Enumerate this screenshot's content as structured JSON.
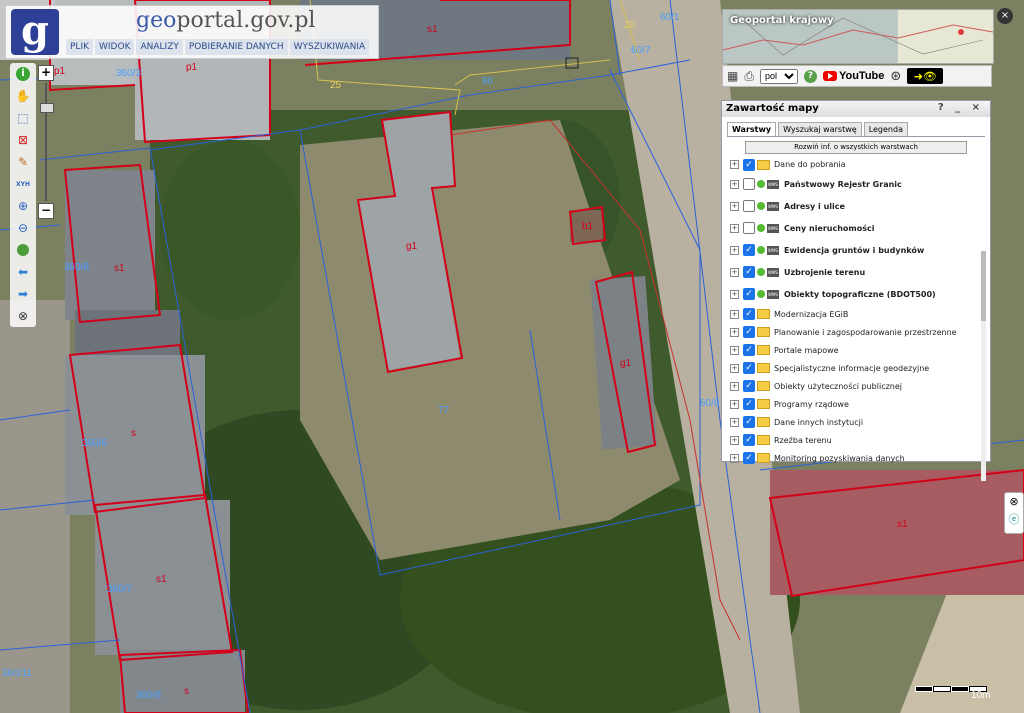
{
  "header": {
    "logo_letter": "g",
    "site_prefix": "geo",
    "site_suffix": "portal.gov.pl",
    "menu": [
      "PLIK",
      "WIDOK",
      "ANALIZY",
      "POBIERANIE DANYCH",
      "WYSZUKIWANIA"
    ]
  },
  "left_tools": {
    "xyh_label": "XYH"
  },
  "zoom": {
    "plus": "+",
    "minus": "−"
  },
  "overview": {
    "title": "Geoportal krajowy"
  },
  "toolbar": {
    "language": "pol",
    "youtube_label": "YouTube",
    "help_symbol": "?"
  },
  "panel": {
    "title": "Zawartość mapy",
    "controls": "? _ ×",
    "tabs": [
      "Warstwy",
      "Wyszukaj warstwę",
      "Legenda"
    ],
    "expand_all": "Rozwiń inf. o wszystkich warstwach",
    "layers": [
      {
        "label": "Dane do pobrania",
        "checked": true,
        "kind": "folder",
        "bold": false
      },
      {
        "label": "Państwowy Rejestr Granic",
        "checked": false,
        "kind": "wms",
        "bold": true
      },
      {
        "label": "Adresy i ulice",
        "checked": false,
        "kind": "wms",
        "bold": true
      },
      {
        "label": "Ceny nieruchomości",
        "checked": false,
        "kind": "wms",
        "bold": true
      },
      {
        "label": "Ewidencja gruntów i budynków",
        "checked": true,
        "kind": "wms",
        "bold": true
      },
      {
        "label": "Uzbrojenie terenu",
        "checked": true,
        "kind": "wms",
        "bold": true
      },
      {
        "label": "Obiekty topograficzne (BDOT500)",
        "checked": true,
        "kind": "wms",
        "bold": true
      },
      {
        "label": "Modernizacja EGiB",
        "checked": true,
        "kind": "folder",
        "bold": false
      },
      {
        "label": "Planowanie i zagospodarowanie przestrzenne",
        "checked": true,
        "kind": "folder",
        "bold": false
      },
      {
        "label": "Portale mapowe",
        "checked": true,
        "kind": "folder",
        "bold": false
      },
      {
        "label": "Specjalistyczne informacje geodezyjne",
        "checked": true,
        "kind": "folder",
        "bold": false
      },
      {
        "label": "Obiekty użyteczności publicznej",
        "checked": true,
        "kind": "folder",
        "bold": false
      },
      {
        "label": "Programy rządowe",
        "checked": true,
        "kind": "folder",
        "bold": false
      },
      {
        "label": "Dane innych instytucji",
        "checked": true,
        "kind": "folder",
        "bold": false
      },
      {
        "label": "Rzeźba terenu",
        "checked": true,
        "kind": "folder",
        "bold": false
      },
      {
        "label": "Monitoring pozyskiwania danych",
        "checked": true,
        "kind": "folder",
        "bold": false
      }
    ]
  },
  "map_labels": {
    "parcels": [
      "360/8",
      "360/3",
      "360/6",
      "360/7",
      "360/8",
      "360/11",
      "360/1",
      "360/7",
      "360/5",
      "60/1",
      "60/3",
      "60/7",
      "60/8"
    ],
    "buildings": [
      "s1",
      "p1",
      "s1",
      "g1",
      "b1",
      "s",
      "s1",
      "g1",
      "s",
      "s1",
      "p1"
    ],
    "numbers": [
      "25",
      "90",
      "77",
      "20",
      "10",
      "6"
    ]
  },
  "scale": {
    "label": "10m"
  }
}
